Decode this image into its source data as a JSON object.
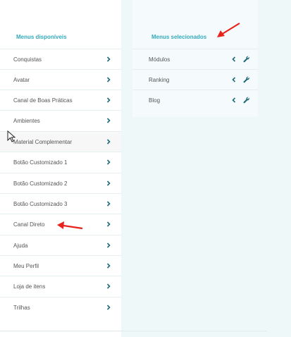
{
  "available": {
    "title": "Menus disponíveis",
    "items": [
      {
        "label": "Conquistas"
      },
      {
        "label": "Avatar"
      },
      {
        "label": "Canal de Boas Práticas"
      },
      {
        "label": "Ambientes"
      },
      {
        "label": "Material Complementar"
      },
      {
        "label": "Botão Customizado 1"
      },
      {
        "label": "Botão Customizado 2"
      },
      {
        "label": "Botão Customizado 3"
      },
      {
        "label": "Canal Direto"
      },
      {
        "label": "Ajuda"
      },
      {
        "label": "Meu Perfil"
      },
      {
        "label": "Loja de itens"
      },
      {
        "label": "Trilhas"
      }
    ]
  },
  "selected": {
    "title": "Menus selecionados",
    "items": [
      {
        "label": "Módulos"
      },
      {
        "label": "Ranking"
      },
      {
        "label": "Blog"
      }
    ]
  },
  "icons": {
    "add": "chevron-right-icon",
    "remove": "chevron-left-icon",
    "config": "wrench-icon",
    "cursor": "mouse-pointer-icon",
    "annotation": "red-arrow-annotation"
  },
  "colors": {
    "accent": "#33aabb",
    "icon": "#1f6b7a",
    "annotation": "#e8221c",
    "background": "#eef8f9"
  }
}
